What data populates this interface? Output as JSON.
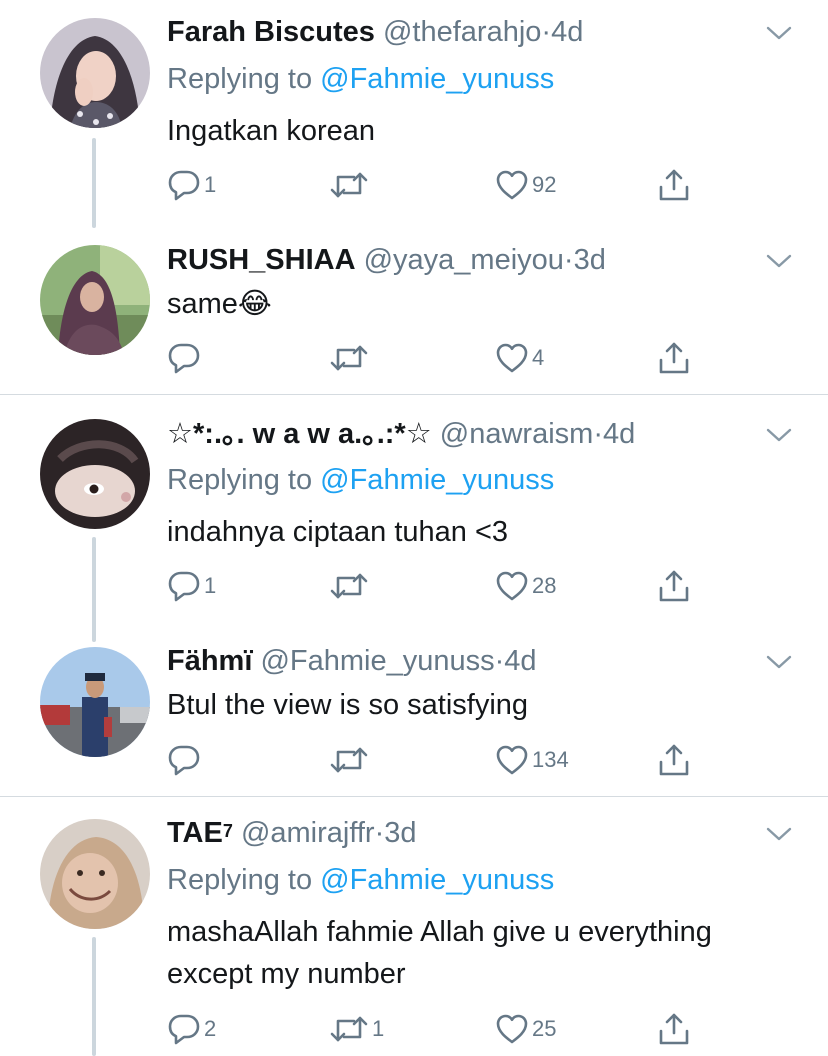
{
  "tweets": [
    {
      "name": "Farah Biscutes",
      "handle": "@thefarahjo",
      "dot": "·",
      "time": "4d",
      "replying_prefix": "Replying to",
      "replying_handle": "@Fahmie_yunuss",
      "text": "Ingatkan korean",
      "replies": "1",
      "retweets": "",
      "likes": "92"
    },
    {
      "name": "RUSH_SHIAA",
      "handle": "@yaya_meiyou",
      "dot": "·",
      "time": "3d",
      "text": "same😂",
      "replies": "",
      "retweets": "",
      "likes": "4"
    },
    {
      "name": "☆*:.｡. w a w a.｡.:*☆",
      "handle": "@nawraism",
      "dot": "·",
      "time": "4d",
      "replying_prefix": "Replying to",
      "replying_handle": "@Fahmie_yunuss",
      "text": "indahnya ciptaan tuhan <3",
      "replies": "1",
      "retweets": "",
      "likes": "28"
    },
    {
      "name": "Fähmï",
      "handle": "@Fahmie_yunuss",
      "dot": "·",
      "time": "4d",
      "text": "Btul the view is so satisfying",
      "replies": "",
      "retweets": "",
      "likes": "134"
    },
    {
      "name": "TAE",
      "name_sup": "7",
      "handle": "@amirajffr",
      "dot": "·",
      "time": "3d",
      "replying_prefix": "Replying to",
      "replying_handle": "@Fahmie_yunuss",
      "text": "mashaAllah fahmie Allah give u everything except my number",
      "replies": "2",
      "retweets": "1",
      "likes": "25"
    }
  ],
  "colors": {
    "text": "#14171a",
    "meta": "#657786",
    "link": "#1da1f2",
    "thread_line": "#ccd6dd",
    "divider": "#d5dbe0"
  },
  "icons": [
    "reply-icon",
    "retweet-icon",
    "like-icon",
    "share-icon",
    "chevron-down-icon"
  ]
}
